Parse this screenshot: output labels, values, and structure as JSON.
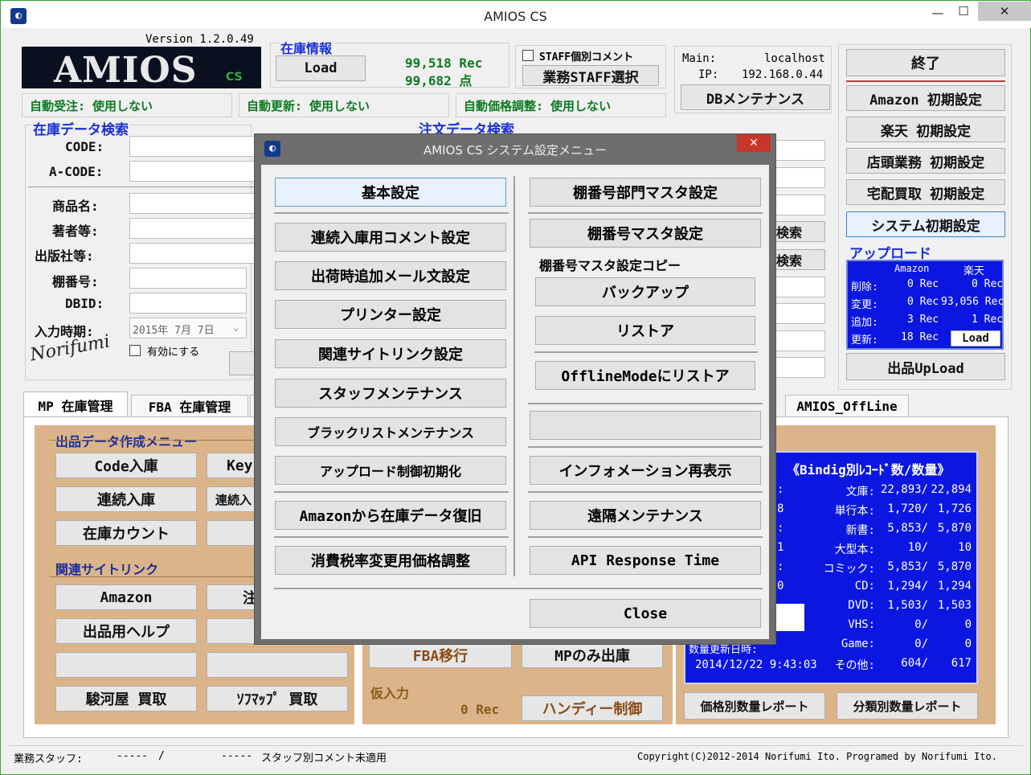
{
  "window": {
    "title": "AMIOS CS",
    "minimize": "—",
    "maximize": "☐",
    "close": "✕"
  },
  "version": "Version 1.2.0.49",
  "logo": {
    "text": "AMIOS",
    "cs": "CS",
    "signature": "Norifumi"
  },
  "stock_info": {
    "title": "在庫情報",
    "load_label": "Load",
    "rec": "99,518 Rec",
    "points": "99,682 点"
  },
  "staff": {
    "checkbox_label": "STAFF個別コメント",
    "select_label": "業務STAFF選択"
  },
  "server": {
    "main_label": "Main:",
    "main_value": "localhost",
    "ip_label": "IP:",
    "ip_value": "192.168.0.44",
    "db_button": "DBメンテナンス"
  },
  "status": {
    "auto_order": "自動受注: 使用しない",
    "auto_update": "自動更新: 使用しない",
    "auto_price": "自動価格調整: 使用しない"
  },
  "stock_search": {
    "title": "在庫データ検索",
    "code": "CODE:",
    "acode": "A-CODE:",
    "product": "商品名:",
    "author": "著者等:",
    "publisher": "出版社等:",
    "shelf": "棚番号:",
    "dbid": "DBID:",
    "input_time": "入力時期:",
    "date_value": "2015年 7月 7日",
    "enable_label": "有効にする"
  },
  "order_search": {
    "title": "注文データ検索",
    "search1": "検索",
    "search2": "検索"
  },
  "right_buttons": {
    "exit": "終了",
    "amazon": "Amazon 初期設定",
    "rakuten": "楽天 初期設定",
    "store": "店頭業務 初期設定",
    "delivery": "宅配買取 初期設定",
    "system": "システム初期設定"
  },
  "upload": {
    "title": "アップロード",
    "col_amazon": "Amazon",
    "col_rakuten": "楽天",
    "rows": [
      {
        "label": "削除:",
        "amazon": "0 Rec",
        "rakuten": "0 Rec"
      },
      {
        "label": "変更:",
        "amazon": "0 Rec",
        "rakuten": "93,056 Rec"
      },
      {
        "label": "追加:",
        "amazon": "3 Rec",
        "rakuten": "1 Rec"
      },
      {
        "label": "更新:",
        "amazon": "18 Rec",
        "rakuten": ""
      }
    ],
    "load_label": "Load",
    "upload_button": "出品UpLoad"
  },
  "tabs": [
    "MP 在庫管理",
    "FBA 在庫管理",
    "AMIOS_OffLine"
  ],
  "listing_menu": {
    "title": "出品データ作成メニュー",
    "code_in": "Code入庫",
    "key": "Key",
    "continuous": "連続入庫",
    "continuous2": "連続入",
    "count": "在庫カウント"
  },
  "related_links": {
    "title": "関連サイトリンク",
    "amazon": "Amazon",
    "chu": "注",
    "help": "出品用ヘルプ",
    "surugaya": "駿河屋 買取",
    "sofmap": "ｿﾌﾏｯﾌﾟ 買取"
  },
  "fba": {
    "fba_move": "FBA移行",
    "mp_only": "MPのみ出庫",
    "temp_title": "仮入力",
    "temp_rec": "0 Rec",
    "handy": "ハンディー制御"
  },
  "binding": {
    "title": "《Bindig別ﾚｺｰﾄﾞ数/数量》",
    "rows": [
      {
        "label": "文庫:",
        "a": "22,893/",
        "b": "22,894"
      },
      {
        "label": "単行本:",
        "a": "1,720/",
        "b": "1,726"
      },
      {
        "label": "新書:",
        "a": "5,853/",
        "b": "5,870"
      },
      {
        "label": "大型本:",
        "a": "10/",
        "b": "10"
      },
      {
        "label": "コミック:",
        "a": "5,853/",
        "b": "5,870"
      },
      {
        "label": "CD:",
        "a": "1,294/",
        "b": "1,294"
      },
      {
        "label": "DVD:",
        "a": "1,503/",
        "b": "1,503"
      },
      {
        "label": "VHS:",
        "a": "0/",
        "b": "0"
      },
      {
        "label": "Game:",
        "a": "0/",
        "b": "0"
      },
      {
        "label": "その他:",
        "a": "604/",
        "b": "617"
      }
    ],
    "left_digits": [
      ":",
      "8",
      ":",
      "1",
      ":",
      "0"
    ],
    "update_label": "数量更新日時:",
    "update_time": "2014/12/22 9:43:03",
    "price_report": "価格別数量レポート",
    "category_report": "分類別数量レポート"
  },
  "footer": {
    "staff_label": "業務スタッフ:",
    "staff_a": "-----",
    "slash": "/",
    "staff_b": "-----",
    "comment": "スタッフ別コメント未適用",
    "copyright": "Copyright(C)2012-2014 Norifumi Ito. Programed by Norifumi Ito."
  },
  "modal": {
    "title": "AMIOS CS システム設定メニュー",
    "close_x": "✕",
    "left": [
      "基本設定",
      "連続入庫用コメント設定",
      "出荷時追加メール文設定",
      "プリンター設定",
      "関連サイトリンク設定",
      "スタッフメンテナンス",
      "ブラックリストメンテナンス",
      "アップロード制御初期化",
      "Amazonから在庫データ復旧",
      "消費税率変更用価格調整"
    ],
    "right_top": [
      "棚番号部門マスタ設定",
      "棚番号マスタ設定"
    ],
    "copy_title": "棚番号マスタ設定コピー",
    "backup": "バックアップ",
    "restore": "リストア",
    "offline_restore": "OfflineModeにリストア",
    "info": "インフォメーション再表示",
    "remote": "遠隔メンテナンス",
    "api": "API Response Time",
    "close": "Close"
  }
}
